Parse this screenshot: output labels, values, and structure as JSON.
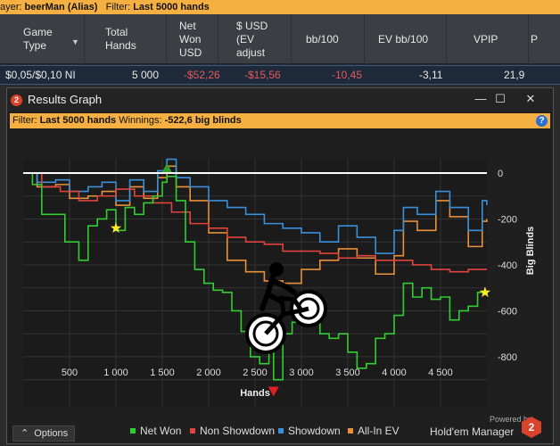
{
  "top_filter": {
    "player_prefix": "ayer:",
    "player_name": "beerMan (Alias)",
    "filter_prefix": "Filter:",
    "filter_value": "Last 5000 hands"
  },
  "table": {
    "headers": [
      {
        "line1": "Game",
        "line2": "Type",
        "line3": "",
        "line4": ""
      },
      {
        "line1": "Total",
        "line2": "Hands",
        "line3": "",
        "line4": ""
      },
      {
        "line1": "Net",
        "line2": "Won",
        "line3": "USD",
        "line4": ""
      },
      {
        "line1": "$ USD",
        "line2": "(EV",
        "line3": "adjust",
        "line4": ""
      },
      {
        "line1": "bb/100",
        "line2": "",
        "line3": "",
        "line4": ""
      },
      {
        "line1": "EV bb/100",
        "line2": "",
        "line3": "",
        "line4": ""
      },
      {
        "line1": "VPIP",
        "line2": "",
        "line3": "",
        "line4": ""
      },
      {
        "line1": "P",
        "line2": "",
        "line3": "",
        "line4": ""
      }
    ],
    "row": {
      "game_type": "$0,05/$0,10 NI",
      "total_hands": "5 000",
      "net_won": "-$52,26",
      "ev_adjust": "-$15,56",
      "bb100": "-10,45",
      "ev_bb100": "-3,11",
      "vpip": "21,9"
    }
  },
  "window": {
    "badge": "2",
    "title": "Results Graph",
    "minimize": "—",
    "maximize": "☐",
    "close": "✕"
  },
  "info": {
    "filter_label": "Filter:",
    "filter_value": "Last 5000 hands",
    "winnings_label": "Winnings:",
    "winnings_value": "-522,6 big blinds",
    "help": "?"
  },
  "colors": {
    "net_won": "#33cc33",
    "non_showdown": "#e0443c",
    "showdown": "#3a8fd8",
    "all_in_ev": "#e8903a",
    "zero_line": "#ffffff"
  },
  "chart_data": {
    "type": "line",
    "xlabel": "Hands",
    "ylabel": "Big Blinds",
    "xlim": [
      0,
      5000
    ],
    "ylim": [
      -1000,
      0
    ],
    "x_ticks": [
      500,
      1000,
      1500,
      2000,
      2500,
      3000,
      3500,
      4000,
      4500
    ],
    "x_tick_labels": [
      "500",
      "1 000",
      "1 500",
      "2 000",
      "2 500",
      "3 000",
      "3 500",
      "4 000",
      "4 500"
    ],
    "y_ticks": [
      0,
      -200,
      -400,
      -600,
      -800
    ],
    "y_tick_labels": [
      "0",
      "-200",
      "-400",
      "-600",
      "-800"
    ],
    "series": [
      {
        "name": "Net Won",
        "x": [
          0,
          100,
          200,
          300,
          450,
          600,
          700,
          800,
          900,
          1000,
          1100,
          1200,
          1300,
          1400,
          1500,
          1550,
          1650,
          1750,
          1850,
          1950,
          2050,
          2150,
          2250,
          2350,
          2450,
          2550,
          2650,
          2700,
          2800,
          2900,
          3000,
          3100,
          3200,
          3300,
          3400,
          3500,
          3600,
          3700,
          3800,
          3900,
          4000,
          4100,
          4200,
          4300,
          4400,
          4500,
          4600,
          4700,
          4800,
          4900,
          5000
        ],
        "y": [
          0,
          -50,
          -180,
          -180,
          -300,
          -380,
          -230,
          -200,
          -160,
          -250,
          -150,
          -180,
          -130,
          -100,
          -40,
          -15,
          -120,
          -300,
          -420,
          -480,
          -510,
          -520,
          -600,
          -690,
          -800,
          -830,
          -780,
          -900,
          -700,
          -650,
          -630,
          -560,
          -700,
          -720,
          -700,
          -780,
          -850,
          -830,
          -720,
          -700,
          -620,
          -480,
          -540,
          -500,
          -550,
          -540,
          -640,
          -600,
          -580,
          -520,
          -530
        ]
      },
      {
        "name": "Non Showdown",
        "x": [
          0,
          200,
          400,
          600,
          800,
          1000,
          1200,
          1400,
          1600,
          1800,
          2000,
          2200,
          2400,
          2600,
          2800,
          3000,
          3200,
          3400,
          3600,
          3800,
          4000,
          4200,
          4400,
          4600,
          4800,
          5000
        ],
        "y": [
          0,
          -60,
          -80,
          -120,
          -100,
          -70,
          -100,
          -130,
          -170,
          -220,
          -240,
          -280,
          -300,
          -310,
          -340,
          -340,
          -350,
          -370,
          -360,
          -380,
          -380,
          -400,
          -420,
          -430,
          -420,
          -420
        ]
      },
      {
        "name": "Showdown",
        "x": [
          0,
          150,
          350,
          500,
          700,
          850,
          1000,
          1150,
          1300,
          1450,
          1550,
          1650,
          1800,
          2000,
          2200,
          2400,
          2600,
          2800,
          3000,
          3200,
          3400,
          3600,
          3800,
          4000,
          4100,
          4250,
          4450,
          4600,
          4800,
          4950,
          5000
        ],
        "y": [
          0,
          -40,
          -30,
          -80,
          -60,
          -40,
          -120,
          -30,
          -80,
          10,
          60,
          -20,
          -60,
          -120,
          -150,
          -180,
          -220,
          -240,
          -260,
          -300,
          -230,
          -280,
          -350,
          -250,
          -150,
          -180,
          -80,
          -150,
          -250,
          -120,
          -140
        ]
      },
      {
        "name": "All-In EV",
        "x": [
          0,
          150,
          350,
          500,
          700,
          850,
          1000,
          1150,
          1300,
          1450,
          1550,
          1650,
          1800,
          2000,
          2200,
          2400,
          2600,
          2800,
          3000,
          3200,
          3400,
          3600,
          3800,
          4000,
          4100,
          4250,
          4450,
          4600,
          4800,
          4950,
          5000
        ],
        "y": [
          0,
          -60,
          -50,
          -110,
          -100,
          -80,
          -140,
          -60,
          -110,
          -20,
          30,
          -60,
          -120,
          -260,
          -380,
          -430,
          -470,
          -480,
          -420,
          -380,
          -330,
          -370,
          -440,
          -360,
          -210,
          -250,
          -120,
          -190,
          -320,
          -210,
          -200
        ]
      }
    ],
    "markers": [
      {
        "type": "star",
        "x": 1000,
        "y": -240,
        "color": "#ffee22"
      },
      {
        "type": "up-triangle",
        "x": 1550,
        "y": 20,
        "color": "#2fa02f"
      },
      {
        "type": "down-triangle",
        "x": 2700,
        "y": -950,
        "color": "#e02020"
      },
      {
        "type": "star",
        "x": 4980,
        "y": -520,
        "color": "#ffee22"
      }
    ]
  },
  "footer": {
    "options_label": "Options",
    "options_caret": "⌃",
    "legend": [
      {
        "label": "Net Won",
        "color": "#33cc33"
      },
      {
        "label": "Non Showdown",
        "color": "#e0443c"
      },
      {
        "label": "Showdown",
        "color": "#3a8fd8"
      },
      {
        "label": "All-In EV",
        "color": "#e8903a"
      }
    ],
    "powered_by": "Powered by",
    "brand": "Hold'em Manager",
    "brand_logo": "2"
  }
}
